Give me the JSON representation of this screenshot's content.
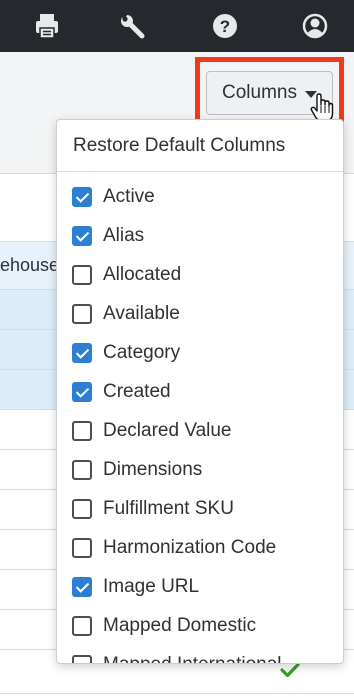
{
  "topbar": {
    "icons": [
      "printer-icon",
      "wrench-icon",
      "help-icon",
      "user-icon"
    ]
  },
  "toolbar": {
    "columns_label": "Columns"
  },
  "table": {
    "partial_header": "ehouse"
  },
  "menu": {
    "restore_label": "Restore Default Columns",
    "options": [
      {
        "label": "Active",
        "checked": true
      },
      {
        "label": "Alias",
        "checked": true
      },
      {
        "label": "Allocated",
        "checked": false
      },
      {
        "label": "Available",
        "checked": false
      },
      {
        "label": "Category",
        "checked": true
      },
      {
        "label": "Created",
        "checked": true
      },
      {
        "label": "Declared Value",
        "checked": false
      },
      {
        "label": "Dimensions",
        "checked": false
      },
      {
        "label": "Fulfillment SKU",
        "checked": false
      },
      {
        "label": "Harmonization Code",
        "checked": false
      },
      {
        "label": "Image URL",
        "checked": true
      },
      {
        "label": "Mapped Domestic",
        "checked": false
      },
      {
        "label": "Mapped International",
        "checked": false
      }
    ]
  },
  "colors": {
    "topbar": "#25292d",
    "highlight": "#f03a1c",
    "checkbox_on": "#2d7fd3",
    "checkmark": "#3c9a2e"
  }
}
